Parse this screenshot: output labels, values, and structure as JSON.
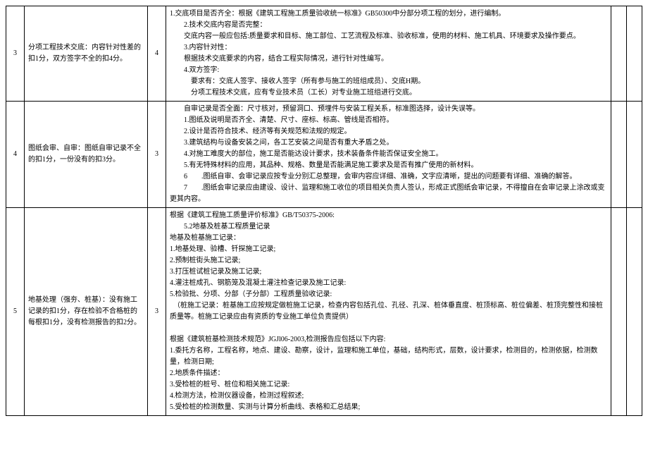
{
  "rows": [
    {
      "num": "3",
      "desc": "分项工程技术交底：内容针对性差的扣1分，双方签字不全的扣4分。",
      "score": "4",
      "content": [
        "1.交底项目是否齐全：根据《建筑工程施工质量验收统一标准》GB50300中分部分项工程的划分，进行编制。",
        "　　2.技术交底内容是否完整：",
        "　　交底内容一般应包括:质量要求和目标、施工部位、工艺流程及标准、验收标准，使用的材料、施工机具、环境要求及操作要点。",
        "　　3.内容针对性：",
        "　　根据技术交底要求的内容，结合工程实际情况，进行针对性编写。",
        "　　4.双方签字:",
        "　　　要求有：交底人签字、接收人签字（所有参与施工的班组成员）、交底H期。",
        "　　　分项工程技术交底，应有专业技术员（工长）对专业施工班组进行交底。"
      ]
    },
    {
      "num": "4",
      "desc": "图纸会审、自审：图纸自审记录不全的扣1分，一份没有的扣3分。",
      "score": "3",
      "content": [
        "　　自审记录是否全面：尺寸核对，预留洞口、预埋件与安装工程关系，标准图选择，设计失误等。",
        "　　1.图纸及说明是否齐全、清楚、尺寸、座标、标高、管线是否相符。",
        "　　2.设计是否符合技术、经济等有关规范和法规的规定。",
        "　　3.建筑结构与设备安装之间，各工艺安装之间是否有重大矛盾之处。",
        "　　4.对施工难度大的部位，施工是否能达设计要求，技术装备条件能否保证安全施工。",
        "　　5.有无特殊材料的应用，其品种、规格、数量是否能满足施工要求及是否有推广使用的新材料。",
        "　　6　　.图纸自审、会审记录应按专业分别汇总整理，会审内容应详细、准确，文字应清晰，提出的问题要有详细、准确的解答。",
        "　　7　　.图纸会审记录应由建设、设计、监理和施工收位的项目相关负责人签认，形成正式图纸会审记录，不得擅自在会审记录上涂改或变更其内容。"
      ]
    },
    {
      "num": "5",
      "desc": "地基处理（强夯、桩基）：没有施工记录的扣1分，存在检验不合格桩的每根扣1分，没有检测报告的扣2分。",
      "score": "3",
      "content": [
        "根据《建筑工程施工质量评价标准》GB/T50375-2006:",
        "　　5.2地基及桩基工程质量记录",
        "地基及桩基施工记录：",
        "1.地基处理、验槽、钎探施工记录;",
        "2.预制桩街头施工记录;",
        "3.打压桩试桩记录及施工记录;",
        "4.灌注桩成孔、钢筋笼及混凝土灌注检查记录及施工记录:",
        "5.检验批、分项、分部（子分部）工程质量验收记录:",
        "　（桩施工记录：桩基施工应按规定做桩施工记录，检查内容包括孔位、孔径、孔深、桩体垂直度、桩顶标高、桩位偏差、桩顶完整性和接桩质量等。桩施工记录应由有资质的专业施工单位负责提供）",
        "",
        "根据《建筑桩基检测技术规范》JGJl06-2003,检测报告应包括以下内容:",
        "1.委托方名称，工程名称，地点、建设、勘察，设计，监理和施工单位，基础，结构形式，层数，设计要求，检测目的，检测依据，检测数量，检测日期;",
        "2.地质条件描述：",
        "3.受检桩的桩号、桩位和相关施工记录:",
        "4.检测方法，检测仪器设备，检测过程叙述;",
        "5.受检桩的检测数量、实测与计算分析曲线、表格和汇总结果;"
      ]
    }
  ]
}
